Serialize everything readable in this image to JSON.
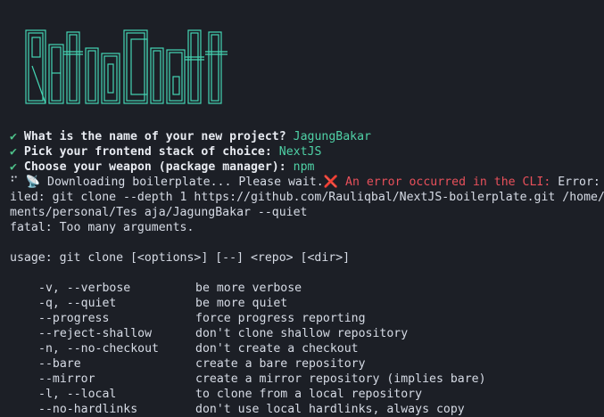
{
  "logo": {
    "text": "RetroCraft",
    "color": "#45d6b4"
  },
  "prompts": [
    {
      "icon": "✔",
      "question": "What is the name of your new project?",
      "answer": "JagungBakar"
    },
    {
      "icon": "✔",
      "question": "Pick your frontend stack of choice:",
      "answer": "NextJS"
    },
    {
      "icon": "✔",
      "question": "Choose your weapon (package manager):",
      "answer": "npm"
    }
  ],
  "status": {
    "spinner": "⠋",
    "download_icon": "📡",
    "downloading": "Downloading boilerplate... Please wait.",
    "error_icon": "❌",
    "error_text": "An error occurred in the CLI:",
    "error_label": "Error:"
  },
  "output": {
    "line1": "iled: git clone --depth 1 https://github.com/Rauliqbal/NextJS-boilerplate.git /home/",
    "line2": "ments/personal/Tes aja/JagungBakar --quiet",
    "line3": "fatal: Too many arguments.",
    "usage": "usage: git clone [<options>] [--] <repo> [<dir>]"
  },
  "options": [
    {
      "flag": "-v, --verbose",
      "desc": "be more verbose"
    },
    {
      "flag": "-q, --quiet",
      "desc": "be more quiet"
    },
    {
      "flag": "--progress",
      "desc": "force progress reporting"
    },
    {
      "flag": "--reject-shallow",
      "desc": "don't clone shallow repository"
    },
    {
      "flag": "-n, --no-checkout",
      "desc": "don't create a checkout"
    },
    {
      "flag": "--bare",
      "desc": "create a bare repository"
    },
    {
      "flag": "--mirror",
      "desc": "create a mirror repository (implies bare)"
    },
    {
      "flag": "-l, --local",
      "desc": "to clone from a local repository"
    },
    {
      "flag": "--no-hardlinks",
      "desc": "don't use local hardlinks, always copy"
    }
  ]
}
